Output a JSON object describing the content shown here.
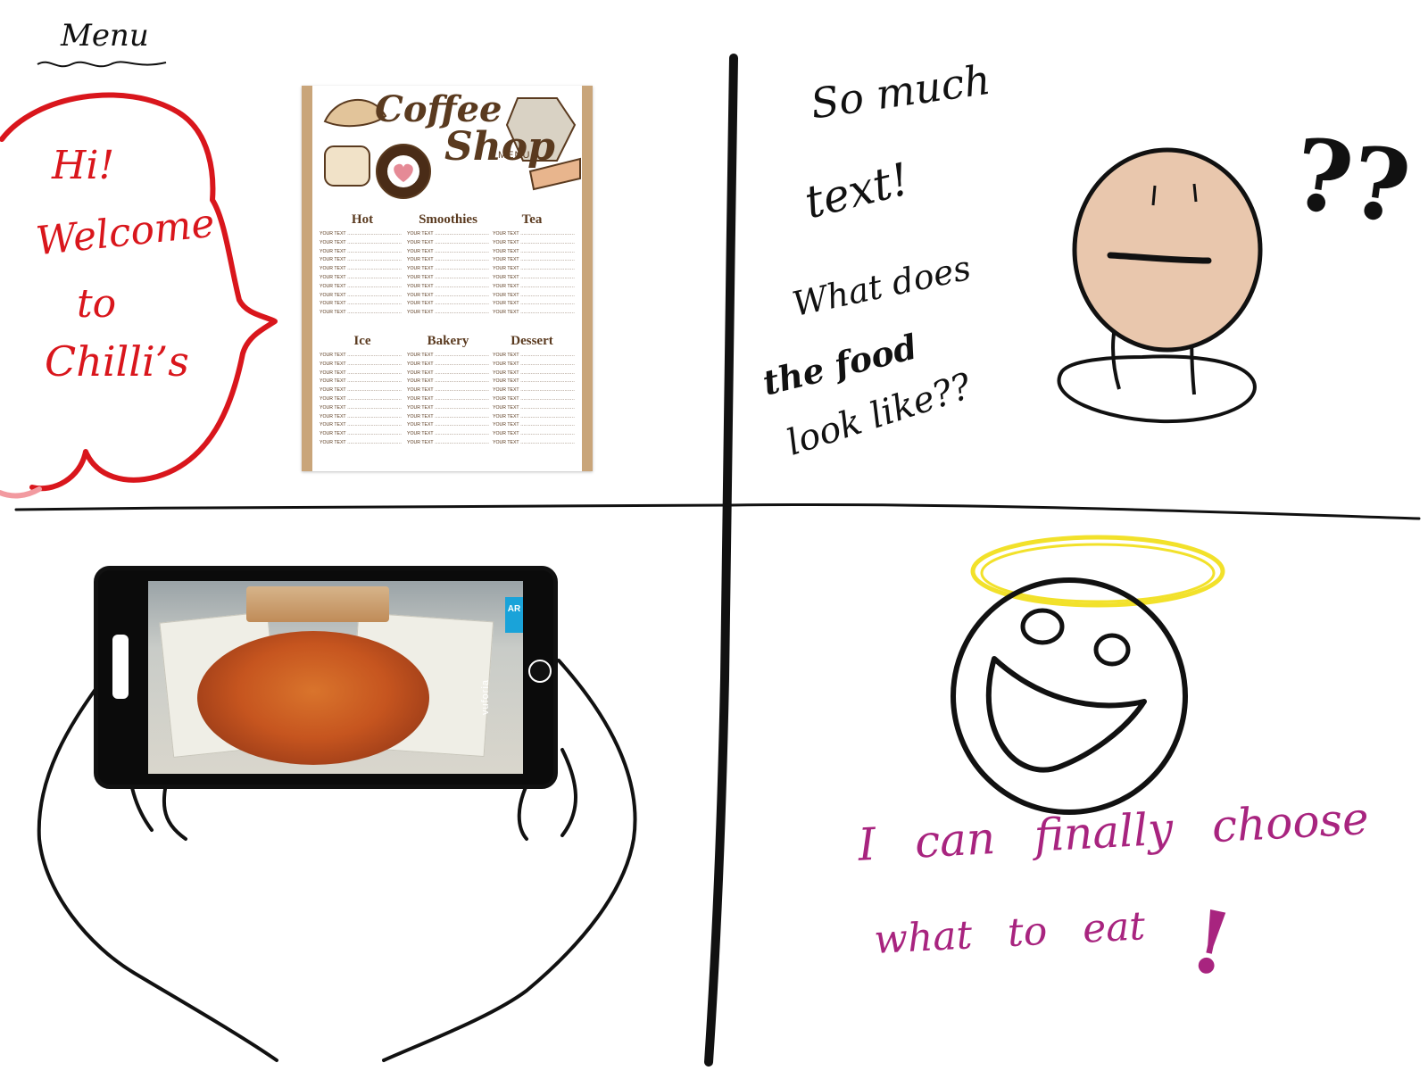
{
  "panel1": {
    "heading": "Menu",
    "speech_lines": [
      "Hi!",
      "Welcome",
      "to",
      "Chilli’s"
    ],
    "menu_card": {
      "brand_top": "Coffee",
      "brand_bottom": "Shop",
      "brand_tag": "MENU",
      "sections": [
        {
          "title": "Hot",
          "item": "YOUR TEXT"
        },
        {
          "title": "Smoothies",
          "item": "YOUR TEXT"
        },
        {
          "title": "Tea",
          "item": "YOUR TEXT"
        },
        {
          "title": "Ice",
          "item": "YOUR TEXT"
        },
        {
          "title": "Bakery",
          "item": "YOUR TEXT"
        },
        {
          "title": "Dessert",
          "item": "YOUR TEXT"
        }
      ]
    }
  },
  "panel2": {
    "lines": [
      "So much",
      "text!",
      "What does",
      "the food",
      "look like??"
    ],
    "question_marks": "??"
  },
  "panel3": {
    "ar_badge": "AR",
    "watermark": "vuforia"
  },
  "panel4": {
    "caption_line1": "I can finally choose",
    "caption_line2": "what to eat",
    "exclaim": "!"
  },
  "colors": {
    "ink": "#111111",
    "speech_red": "#d9161c",
    "caption_magenta": "#a8247f",
    "halo_yellow": "#f2e12a",
    "skin": "#e9c7ad"
  }
}
